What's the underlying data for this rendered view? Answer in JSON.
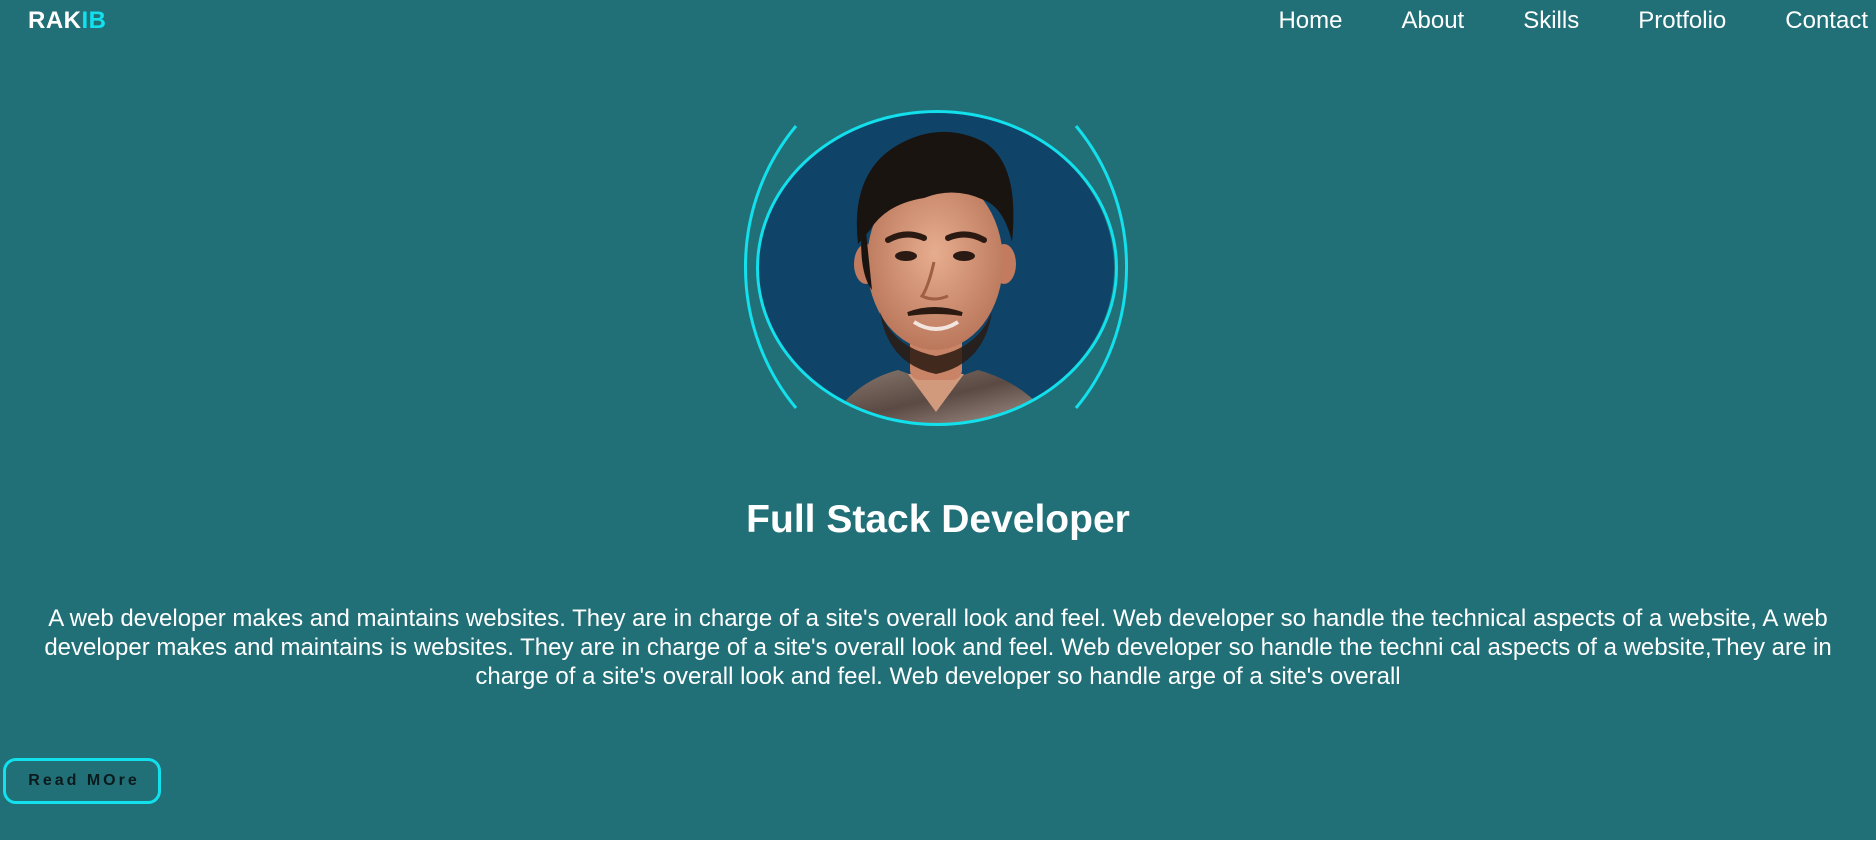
{
  "header": {
    "logo_primary": "RAK",
    "logo_accent": "IB",
    "nav": [
      "Home",
      "About",
      "Skills",
      "Protfolio",
      "Contact"
    ]
  },
  "hero": {
    "photo": "profile-photo",
    "title": "Full Stack Developer",
    "description": "A web developer makes and maintains websites. They are in charge of a site's overall look and feel. Web developer so handle the technical aspects of a website, A web developer makes and maintains is websites. They are in charge of a site's overall look and feel. Web developer so handle the techni cal aspects of a website,They are in charge of a site's overall look and feel. Web developer so handle arge of a site's overall",
    "cta_label": "Read MOre"
  },
  "colors": {
    "background": "#217077",
    "accent": "#12e0ec",
    "text": "#ffffff",
    "photo_background": "#0f4468"
  }
}
